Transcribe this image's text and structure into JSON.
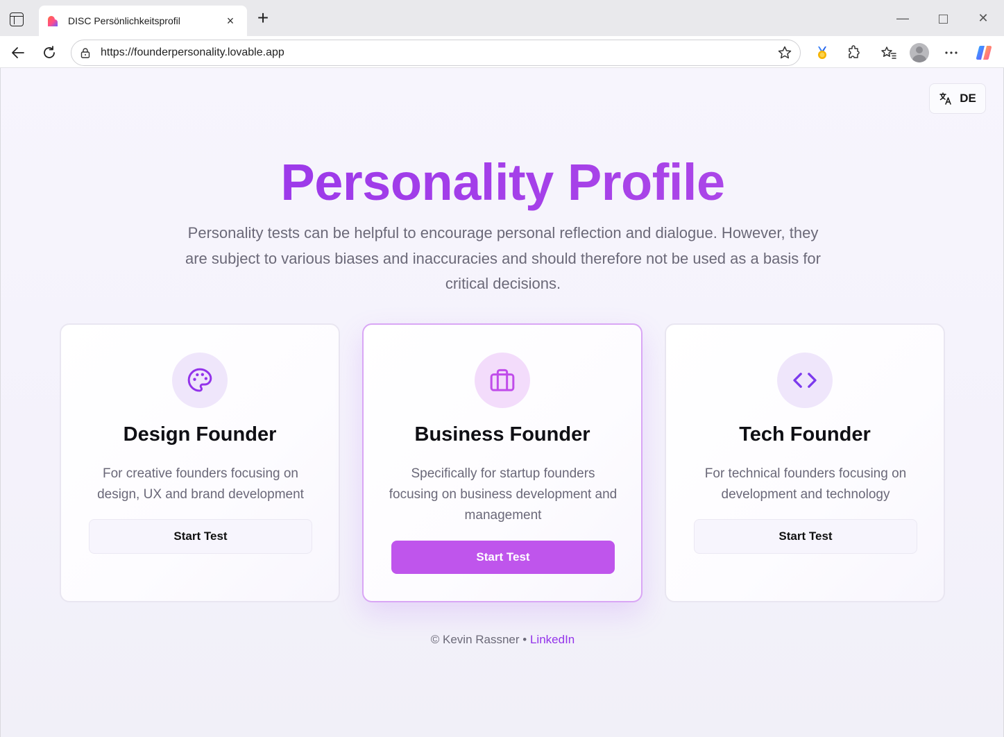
{
  "browser": {
    "tab_title": "DISC Persönlichkeitsprofil",
    "url": "https://founderpersonality.lovable.app",
    "tab_close": "×",
    "new_tab": "+",
    "minimize": "—",
    "close": "✕"
  },
  "page": {
    "language_toggle": {
      "label": "DE",
      "icon": "translate-icon"
    },
    "title": "Personality Profile",
    "subtitle": "Personality tests can be helpful to encourage personal reflection and dialogue. However, they are subject to various biases and inaccuracies and should therefore not be used as a basis for critical decisions.",
    "cards": [
      {
        "icon": "palette-icon",
        "title": "Design Founder",
        "description": "For creative founders focusing on design, UX and brand development",
        "button": "Start Test"
      },
      {
        "icon": "briefcase-icon",
        "title": "Business Founder",
        "description": "Specifically for startup founders focusing on business development and management",
        "button": "Start Test"
      },
      {
        "icon": "code-icon",
        "title": "Tech Founder",
        "description": "For technical founders focusing on development and technology",
        "button": "Start Test"
      }
    ],
    "footer": {
      "copyright": "© Kevin Rassner",
      "separator": " • ",
      "link": "LinkedIn"
    }
  },
  "colors": {
    "accent": "#9333ea",
    "primary_button": "#bf55ec",
    "icon_bg": "#efe6fb",
    "page_bg": "#f6f4fc"
  }
}
